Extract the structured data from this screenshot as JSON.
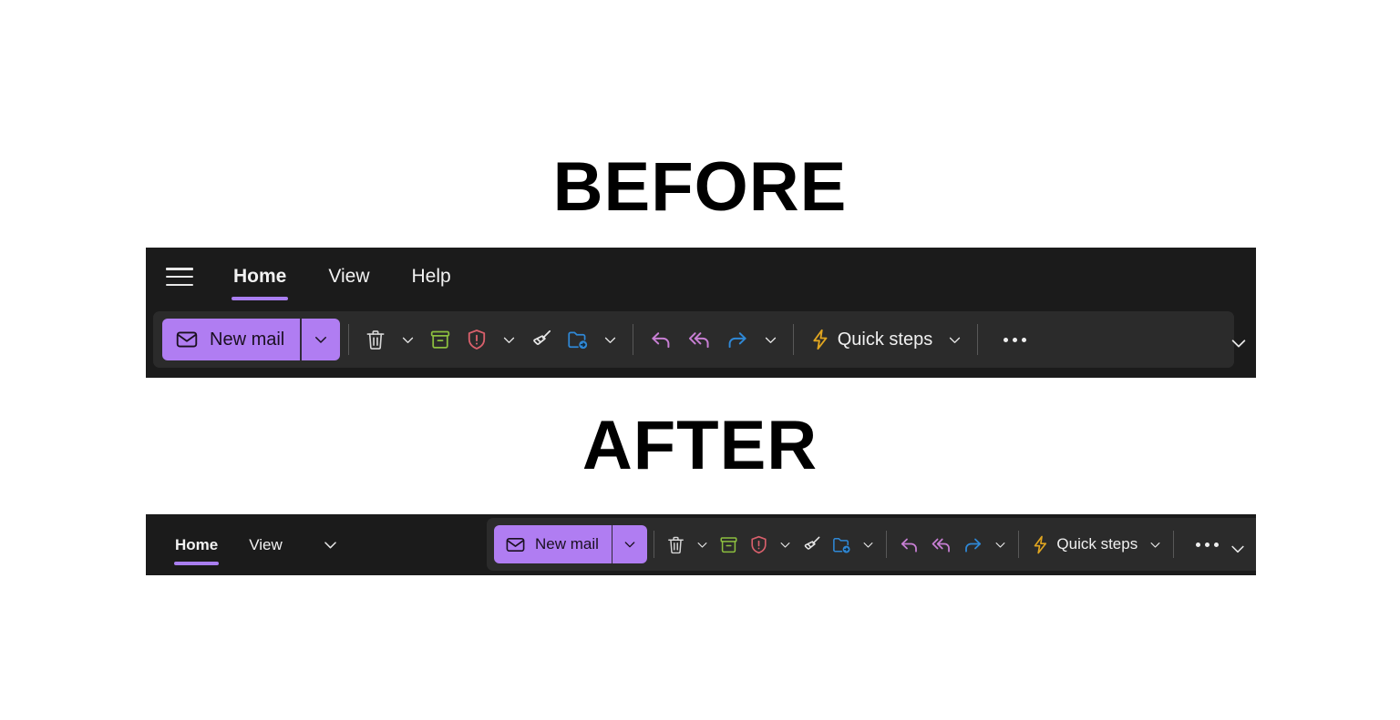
{
  "headings": {
    "before": "BEFORE",
    "after": "AFTER"
  },
  "colors": {
    "page_background": "#ffffff",
    "ribbon_background": "#1b1b1b",
    "command_panel_background": "#2b2b2b",
    "accent_purple": "#a97ef0",
    "new_mail_button": "#b07df2",
    "icon_delete": "#d6d6d6",
    "icon_archive": "#8cbf3f",
    "icon_report": "#d9606c",
    "icon_sweep": "#e8e8e8",
    "icon_move": "#2f88d6",
    "icon_reply": "#c87fd4",
    "icon_reply_all": "#c87fd4",
    "icon_forward": "#2f88d6",
    "icon_quick_steps": "#e0a520",
    "text_primary": "#f2f2f2"
  },
  "before": {
    "menu_button": "Menu",
    "tabs": [
      {
        "label": "Home",
        "selected": true
      },
      {
        "label": "View",
        "selected": false
      },
      {
        "label": "Help",
        "selected": false
      }
    ],
    "new_mail": {
      "label": "New mail",
      "icon": "mail-envelope-icon",
      "dropdown": "new-mail-options"
    },
    "commands": [
      {
        "id": "delete",
        "icon": "trash-icon",
        "label": "",
        "has_caret": true
      },
      {
        "id": "archive",
        "icon": "archive-box-icon",
        "label": "",
        "has_caret": false
      },
      {
        "id": "report",
        "icon": "shield-alert-icon",
        "label": "",
        "has_caret": true
      },
      {
        "id": "sweep",
        "icon": "broom-icon",
        "label": "",
        "has_caret": false
      },
      {
        "id": "move-to",
        "icon": "folder-arrow-icon",
        "label": "",
        "has_caret": true
      },
      {
        "id": "reply",
        "icon": "reply-arrow-icon",
        "label": "",
        "has_caret": false
      },
      {
        "id": "reply-all",
        "icon": "reply-all-arrow-icon",
        "label": "",
        "has_caret": false
      },
      {
        "id": "forward",
        "icon": "forward-arrow-icon",
        "label": "",
        "has_caret": true
      },
      {
        "id": "quick-steps",
        "icon": "lightning-bolt-icon",
        "label": "Quick steps",
        "has_caret": true
      },
      {
        "id": "more",
        "icon": "ellipsis-icon",
        "label": "",
        "has_caret": false
      }
    ],
    "collapse_ribbon": "collapse-ribbon-chevron"
  },
  "after": {
    "tabs": [
      {
        "label": "Home",
        "selected": true
      },
      {
        "label": "View",
        "selected": false
      }
    ],
    "tab_overflow": "more-tabs-chevron",
    "new_mail": {
      "label": "New mail",
      "icon": "mail-envelope-icon",
      "dropdown": "new-mail-options"
    },
    "commands": [
      {
        "id": "delete",
        "icon": "trash-icon",
        "label": "",
        "has_caret": true
      },
      {
        "id": "archive",
        "icon": "archive-box-icon",
        "label": "",
        "has_caret": false
      },
      {
        "id": "report",
        "icon": "shield-alert-icon",
        "label": "",
        "has_caret": true
      },
      {
        "id": "sweep",
        "icon": "broom-icon",
        "label": "",
        "has_caret": false
      },
      {
        "id": "move-to",
        "icon": "folder-arrow-icon",
        "label": "",
        "has_caret": true
      },
      {
        "id": "reply",
        "icon": "reply-arrow-icon",
        "label": "",
        "has_caret": false
      },
      {
        "id": "reply-all",
        "icon": "reply-all-arrow-icon",
        "label": "",
        "has_caret": false
      },
      {
        "id": "forward",
        "icon": "forward-arrow-icon",
        "label": "",
        "has_caret": true
      },
      {
        "id": "quick-steps",
        "icon": "lightning-bolt-icon",
        "label": "Quick steps",
        "has_caret": true
      },
      {
        "id": "more",
        "icon": "ellipsis-icon",
        "label": "",
        "has_caret": false
      }
    ],
    "collapse_ribbon": "collapse-ribbon-chevron"
  }
}
